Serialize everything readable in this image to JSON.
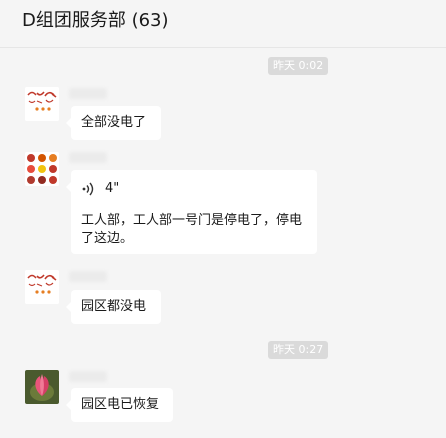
{
  "header": {
    "title": "D组团服务部 (63)"
  },
  "timestamps": {
    "t1": "昨天 0:02",
    "t2": "昨天 0:27"
  },
  "messages": [
    {
      "text": "全部没电了"
    },
    {
      "voice_duration": "4\"",
      "transcript": "工人部，工人部一号门是停电了，停电了这边。"
    },
    {
      "text": "园区都没电"
    },
    {
      "text": "园区电已恢复"
    }
  ],
  "colors": {
    "background": "#f5f5f5",
    "bubble": "#ffffff",
    "timestamp_bg": "#dadada"
  },
  "icons": [
    "voice-wave-icon"
  ]
}
